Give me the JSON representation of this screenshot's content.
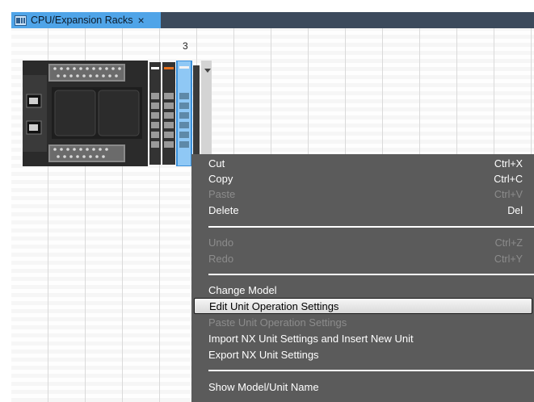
{
  "tab": {
    "label": "CPU/Expansion Racks",
    "close_glyph": "×",
    "icon": "rack-icon",
    "accent": "#4fa4e8"
  },
  "canvas": {
    "slot_number": "3"
  },
  "context_menu": {
    "cut": {
      "label": "Cut",
      "shortcut": "Ctrl+X"
    },
    "copy": {
      "label": "Copy",
      "shortcut": "Ctrl+C"
    },
    "paste": {
      "label": "Paste",
      "shortcut": "Ctrl+V"
    },
    "delete": {
      "label": "Delete",
      "shortcut": "Del"
    },
    "undo": {
      "label": "Undo",
      "shortcut": "Ctrl+Z"
    },
    "redo": {
      "label": "Redo",
      "shortcut": "Ctrl+Y"
    },
    "change_model": {
      "label": "Change Model"
    },
    "edit_unit_operation_settings": {
      "label": "Edit Unit Operation Settings"
    },
    "paste_unit_operation_settings": {
      "label": "Paste Unit Operation Settings"
    },
    "import_nx_unit_settings": {
      "label": "Import NX Unit Settings and Insert New Unit"
    },
    "export_nx_unit_settings": {
      "label": "Export NX Unit Settings"
    },
    "show_model_unit_name": {
      "label": "Show Model/Unit Name"
    }
  },
  "colors": {
    "menu_background": "#5b5b5b",
    "menu_disabled_text": "#8c8c8c",
    "tab_bar": "#3c4a5c"
  }
}
